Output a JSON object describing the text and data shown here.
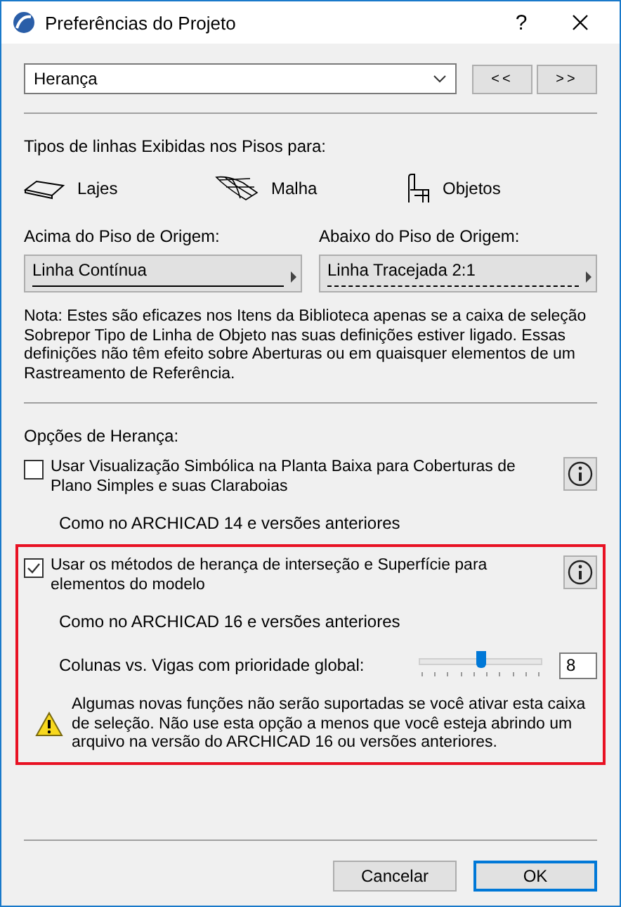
{
  "window": {
    "title": "Preferências do Projeto",
    "help": "?"
  },
  "page_selector": {
    "value": "Herança"
  },
  "nav_buttons": [
    "<<",
    ">>"
  ],
  "line_types": {
    "label": "Tipos de linhas Exibidas nos Pisos para:",
    "items": [
      {
        "kind": "slab",
        "label": "Lajes"
      },
      {
        "kind": "mesh",
        "label": "Malha"
      },
      {
        "kind": "object",
        "label": "Objetos"
      }
    ]
  },
  "line_settings": [
    {
      "label": "Acima do Piso de Origem:",
      "value": "Linha Contínua",
      "kind": "solid"
    },
    {
      "label": "Abaixo do Piso de Origem:",
      "value": "Linha Tracejada 2:1",
      "kind": "dashed"
    }
  ],
  "note": "Nota: Estes são eficazes nos Itens da Biblioteca apenas se a caixa de seleção Sobrepor Tipo de Linha de Objeto nas suas definições estiver ligado. Essas definições não têm efeito sobre Aberturas ou em quaisquer elementos de um Rastreamento de Referência.",
  "inheritance": {
    "label": "Opções de Herança:",
    "options": [
      {
        "checked": false,
        "highlighted": false,
        "label": "Usar Visualização Simbólica na Planta Baixa para Coberturas de Plano Simples e suas Claraboias",
        "note": "Como no ARCHICAD 14 e versões anteriores"
      },
      {
        "checked": true,
        "highlighted": true,
        "label": "Usar os métodos de herança de interseção e Superfície para elementos do modelo",
        "note": "Como no ARCHICAD 16 e versões anteriores",
        "slider": {
          "label": "Colunas vs. Vigas com prioridade global:",
          "level": 0.5,
          "value": "8"
        },
        "warning": "Algumas novas funções não serão suportadas se você ativar esta caixa de seleção. Não use esta opção a menos que você esteja abrindo um arquivo na versão do ARCHICAD 16 ou versões anteriores."
      }
    ]
  },
  "buttons": [
    {
      "label": "Cancelar",
      "default": false
    },
    {
      "label": "OK",
      "default": true
    }
  ]
}
